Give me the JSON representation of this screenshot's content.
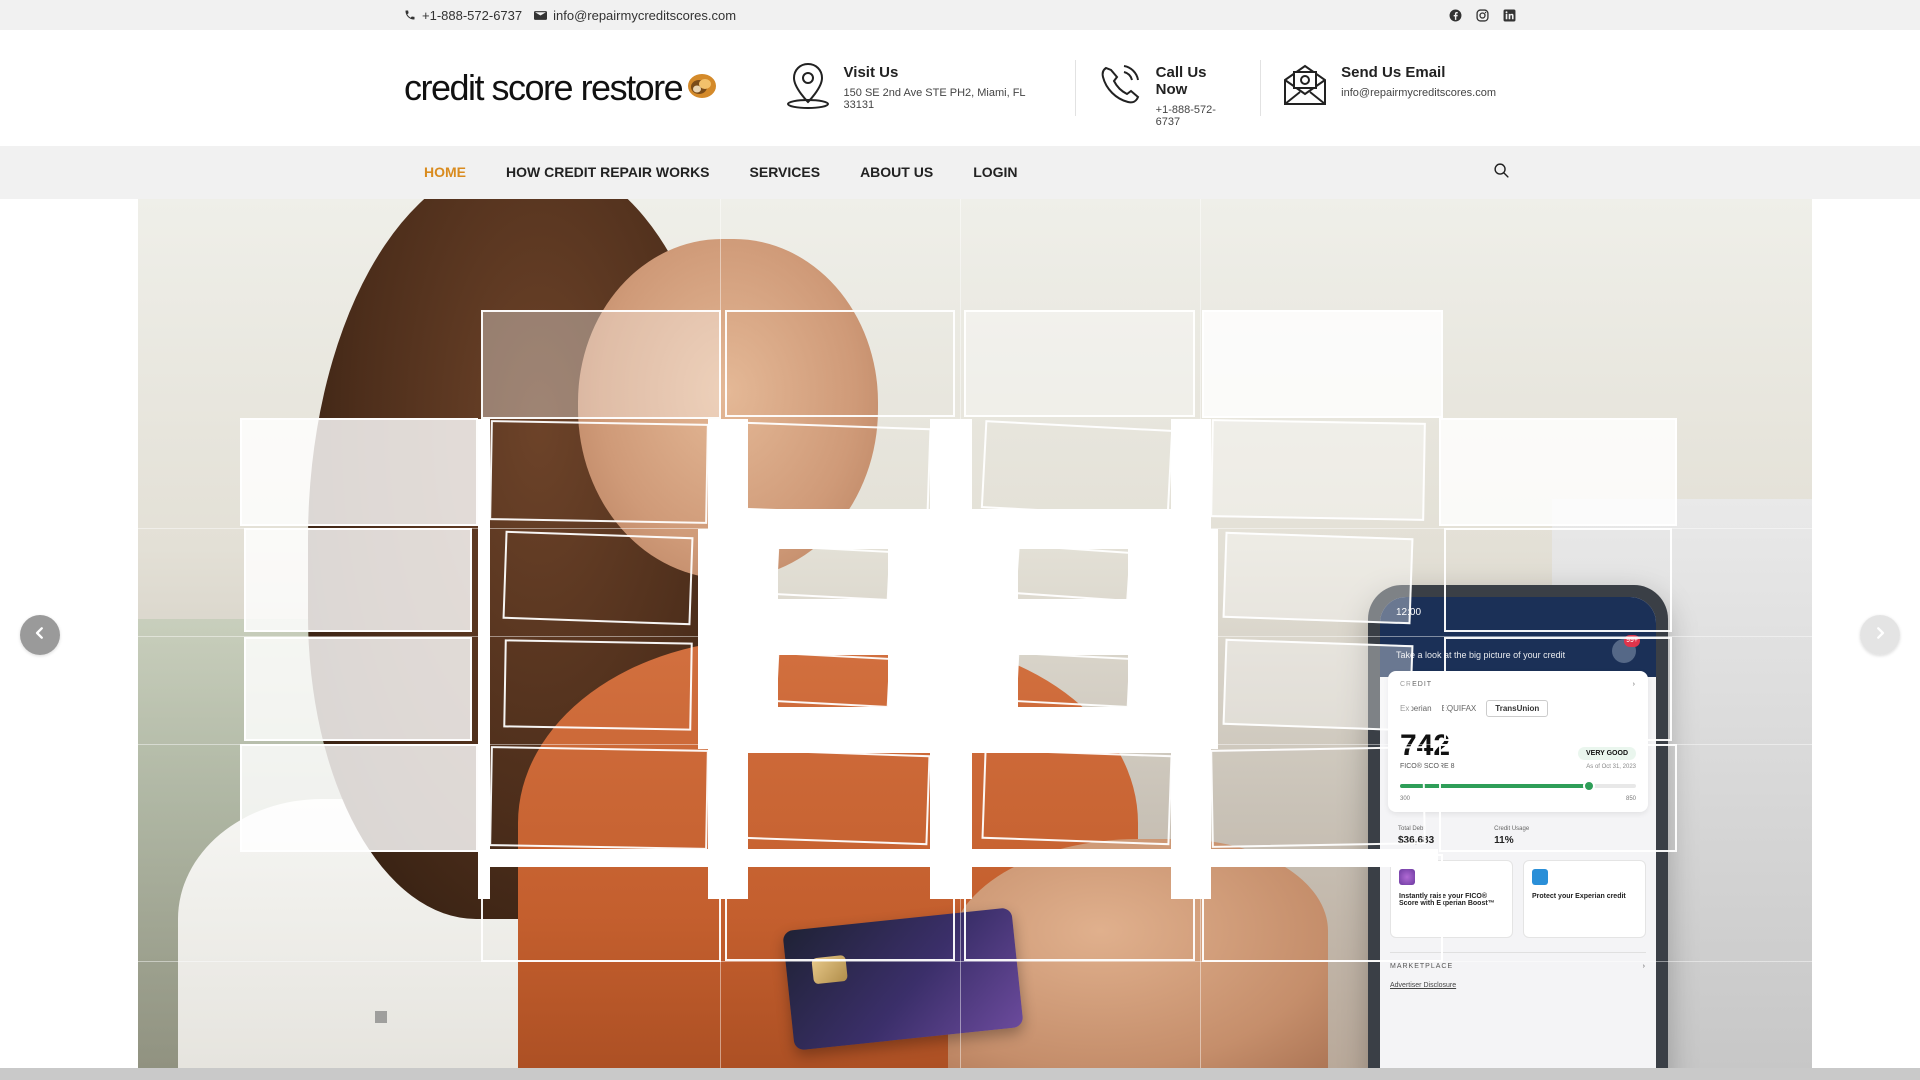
{
  "topbar": {
    "phone": "+1-888-572-6737",
    "email": "info@repairmycreditscores.com",
    "social": [
      "facebook-icon",
      "instagram-icon",
      "linkedin-icon"
    ]
  },
  "header": {
    "logo_text": "credit score restore",
    "visit": {
      "title": "Visit Us",
      "value": "150 SE 2nd Ave STE PH2, Miami, FL 33131"
    },
    "call": {
      "title": "Call Us Now",
      "value": "+1-888-572-6737"
    },
    "email": {
      "title": "Send Us Email",
      "value": "info@repairmycreditscores.com"
    }
  },
  "nav": {
    "items": [
      {
        "label": "HOME",
        "active": true
      },
      {
        "label": "HOW CREDIT REPAIR WORKS",
        "active": false
      },
      {
        "label": "SERVICES",
        "active": false
      },
      {
        "label": "ABOUT US",
        "active": false
      },
      {
        "label": "LOGIN",
        "active": false
      }
    ]
  },
  "phone_app": {
    "time": "12:00",
    "greeting": "Take a look at the big picture of your credit",
    "badge": "99+",
    "panel_label": "CREDIT",
    "bureaus": [
      "Experian",
      "EQUIFAX",
      "TransUnion"
    ],
    "score": "742",
    "score_sub": "FICO® SCORE 8",
    "rating": "VERY GOOD",
    "as_of": "As of Oct 31, 2023",
    "range_min": "300",
    "range_max": "850",
    "score_fraction": 0.8,
    "total_debt_label": "Total Debt",
    "total_debt": "$36,683",
    "credit_usage_label": "Credit Usage",
    "credit_usage": "11%",
    "tile1": "Instantly raise your FICO® Score with Experian Boost™",
    "tile2": "Protect your Experian credit",
    "marketplace": "MARKETPLACE",
    "disclosure": "Advertiser Disclosure"
  },
  "colors": {
    "accent": "#d98b1e",
    "topbar_bg": "#f1f1f1",
    "nav_bg": "#f1f1f1"
  }
}
